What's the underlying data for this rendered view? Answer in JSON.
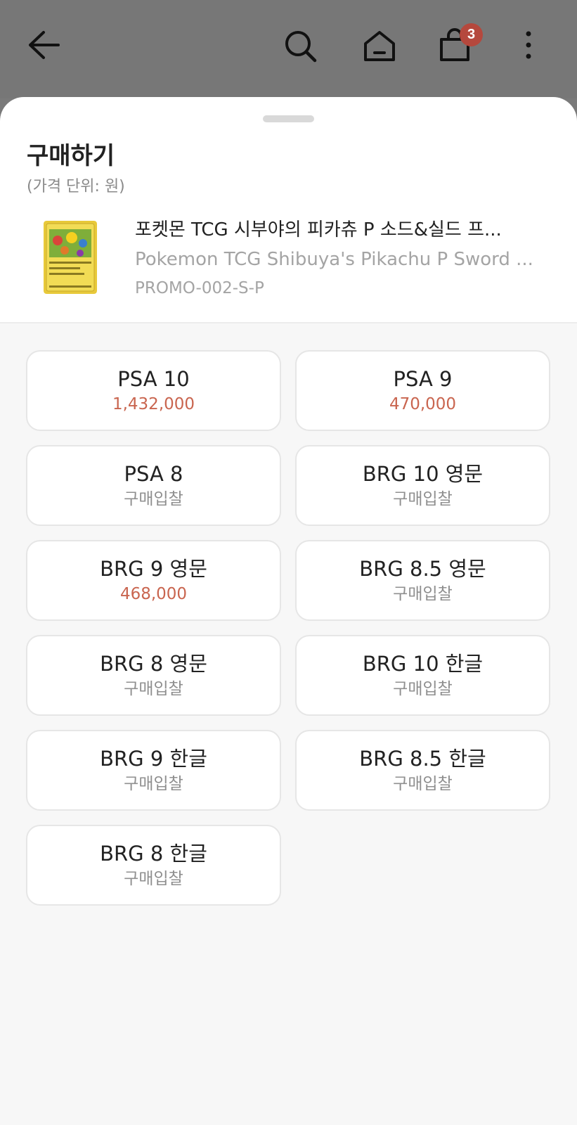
{
  "header": {
    "cart_badge": "3",
    "icons": [
      "back-arrow-icon",
      "search-icon",
      "home-icon",
      "shopping-bag-icon",
      "more-vertical-icon"
    ]
  },
  "sheet": {
    "title": "구매하기",
    "unit_note": "(가격 단위: 원)"
  },
  "product": {
    "name": "포켓몬 TCG 시부야의 피카츄 P 소드&실드 프...",
    "name_en": "Pokemon TCG Shibuya's Pikachu P Sword ...",
    "code": "PROMO-002-S-P"
  },
  "options": [
    {
      "label": "PSA 10",
      "price": "1,432,000",
      "kind": "red"
    },
    {
      "label": "PSA 9",
      "price": "470,000",
      "kind": "red"
    },
    {
      "label": "PSA 8",
      "price": "구매입찰",
      "kind": "gray"
    },
    {
      "label": "BRG 10 영문",
      "price": "구매입찰",
      "kind": "gray"
    },
    {
      "label": "BRG 9 영문",
      "price": "468,000",
      "kind": "red"
    },
    {
      "label": "BRG 8.5 영문",
      "price": "구매입찰",
      "kind": "gray"
    },
    {
      "label": "BRG 8 영문",
      "price": "구매입찰",
      "kind": "gray"
    },
    {
      "label": "BRG 10 한글",
      "price": "구매입찰",
      "kind": "gray"
    },
    {
      "label": "BRG 9 한글",
      "price": "구매입찰",
      "kind": "gray"
    },
    {
      "label": "BRG 8.5 한글",
      "price": "구매입찰",
      "kind": "gray"
    },
    {
      "label": "BRG 8 한글",
      "price": "구매입찰",
      "kind": "gray"
    }
  ],
  "colors": {
    "price_red": "#c9654f",
    "badge": "#b5483d",
    "muted_text": "#8f8f8f"
  }
}
